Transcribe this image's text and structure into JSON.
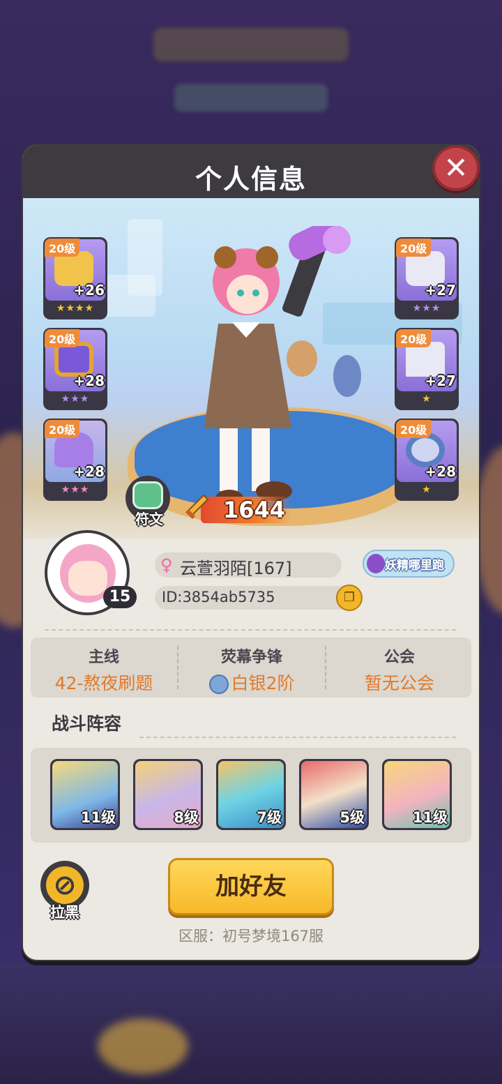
{
  "dialog": {
    "title": "个人信息"
  },
  "equipment_left": [
    {
      "level": "20级",
      "bonus": "+26",
      "stars": "★★★★",
      "color": "#f0c44a"
    },
    {
      "level": "20级",
      "bonus": "+28",
      "stars": "★★★",
      "color": "#7b58d8"
    },
    {
      "level": "20级",
      "bonus": "+28",
      "stars": "★★★",
      "color": "#a77ee6"
    }
  ],
  "equipment_right": [
    {
      "level": "20级",
      "bonus": "+27",
      "stars": "★★★",
      "color": "#e9e9f5"
    },
    {
      "level": "20级",
      "bonus": "+27",
      "stars": "★",
      "color": "#e9e9f5"
    },
    {
      "level": "20级",
      "bonus": "+28",
      "stars": "★",
      "color": "#cfd6f2"
    }
  ],
  "rune": {
    "label": "符文"
  },
  "power": {
    "value": "1644"
  },
  "profile": {
    "gender_symbol": "♀",
    "name": "云萱羽陌[167]",
    "id": "ID:3854ab5735",
    "level": "15",
    "tag": "妖精哪里跑"
  },
  "stats": {
    "mainline": {
      "label": "主线",
      "value": "42-熬夜刷题"
    },
    "arena": {
      "label": "荧幕争锋",
      "value": "白银2阶"
    },
    "guild": {
      "label": "公会",
      "value": "暂无公会"
    }
  },
  "team": {
    "title": "战斗阵容",
    "heroes": [
      {
        "level": "11级",
        "color": "#7fb8e8"
      },
      {
        "level": "8级",
        "color": "#c8b7e8"
      },
      {
        "level": "7级",
        "color": "#6fd3e3"
      },
      {
        "level": "5级",
        "color": "#e86a6a"
      },
      {
        "level": "11级",
        "color": "#f3b3c0"
      }
    ]
  },
  "actions": {
    "block": "拉黑",
    "add_friend": "加好友"
  },
  "server": "区服：初号梦境167服",
  "colors": {
    "accent": "#f2b629",
    "orange_text": "#e07a2c",
    "panel_dark": "#3d3a40",
    "close_red": "#c2444a"
  }
}
